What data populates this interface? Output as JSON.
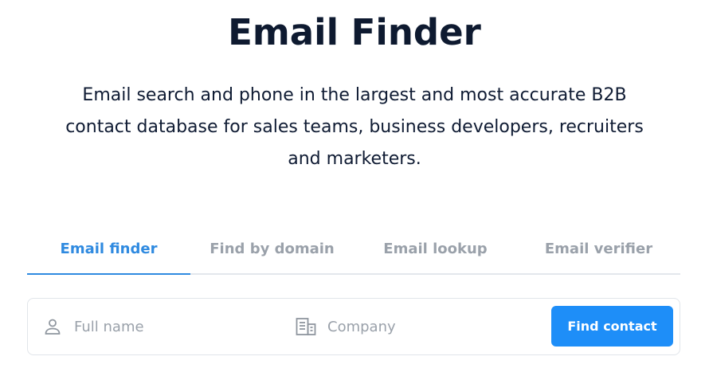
{
  "header": {
    "title": "Email Finder",
    "subtitle": "Email search and phone in the largest and most accurate B2B contact database for sales teams, business developers, recruiters and marketers."
  },
  "tabs": [
    {
      "label": "Email finder",
      "active": true
    },
    {
      "label": "Find by domain",
      "active": false
    },
    {
      "label": "Email lookup",
      "active": false
    },
    {
      "label": "Email verifier",
      "active": false
    }
  ],
  "search": {
    "name_placeholder": "Full name",
    "name_value": "",
    "company_placeholder": "Company",
    "company_value": "",
    "button_label": "Find contact",
    "name_icon": "person-icon",
    "company_icon": "building-icon"
  },
  "colors": {
    "accent": "#1e8ef8",
    "tab_active": "#2f8ae0",
    "tab_inactive": "#9aa1aa",
    "text_dark": "#0e1a30"
  }
}
